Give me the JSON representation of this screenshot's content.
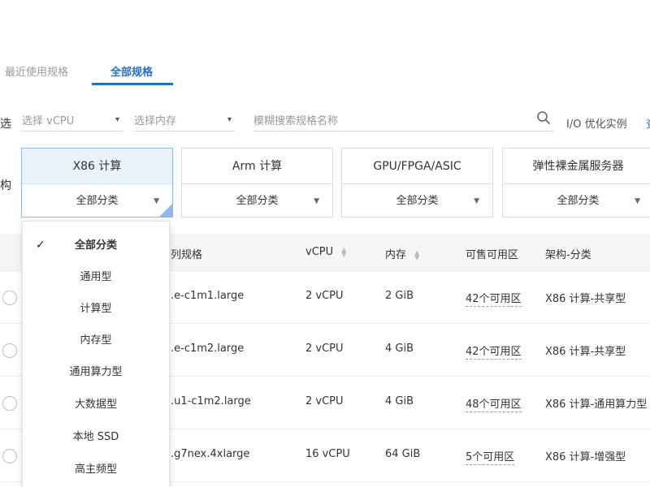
{
  "tabs": [
    {
      "label": "最近使用规格",
      "active": false
    },
    {
      "label": "全部规格",
      "active": true
    }
  ],
  "filters": {
    "side_label": "选",
    "vcpu_placeholder": "选择 vCPU",
    "memory_placeholder": "选择内存",
    "search_placeholder": "模糊搜索规格名称",
    "io_label": "I/O 优化实例",
    "more_link": "查"
  },
  "architecture": {
    "label": "构",
    "cards": [
      {
        "title": "X86 计算",
        "select": "全部分类",
        "active": true
      },
      {
        "title": "Arm 计算",
        "select": "全部分类",
        "active": false
      },
      {
        "title": "GPU/FPGA/ASIC",
        "select": "全部分类",
        "active": false
      },
      {
        "title": "弹性裸金属服务器",
        "select": "全部分类",
        "active": false
      }
    ]
  },
  "dropdown": {
    "items": [
      "全部分类",
      "通用型",
      "计算型",
      "内存型",
      "通用算力型",
      "大数据型",
      "本地 SSD",
      "高主频型"
    ],
    "selected_index": 0
  },
  "table": {
    "headers": {
      "spec": "列规格",
      "vcpu": "vCPU",
      "memory": "内存",
      "zones": "可售可用区",
      "arch": "架构-分类"
    },
    "rows": [
      {
        "spec": ".e-c1m1.large",
        "vcpu": "2 vCPU",
        "memory": "2 GiB",
        "zones": "42个可用区",
        "arch": "X86 计算-共享型"
      },
      {
        "spec": ".e-c1m2.large",
        "vcpu": "2 vCPU",
        "memory": "4 GiB",
        "zones": "42个可用区",
        "arch": "X86 计算-共享型"
      },
      {
        "spec": ".u1-c1m2.large",
        "vcpu": "2 vCPU",
        "memory": "4 GiB",
        "zones": "48个可用区",
        "arch": "X86 计算-通用算力型"
      },
      {
        "spec": ".g7nex.4xlarge",
        "vcpu": "16 vCPU",
        "memory": "64 GiB",
        "zones": "5个可用区",
        "arch": "X86 计算-增强型"
      }
    ]
  },
  "colors": {
    "accent": "#1f6fd6",
    "active_card_bg": "#eaf2fc",
    "header_bg": "#f5f6f8"
  }
}
